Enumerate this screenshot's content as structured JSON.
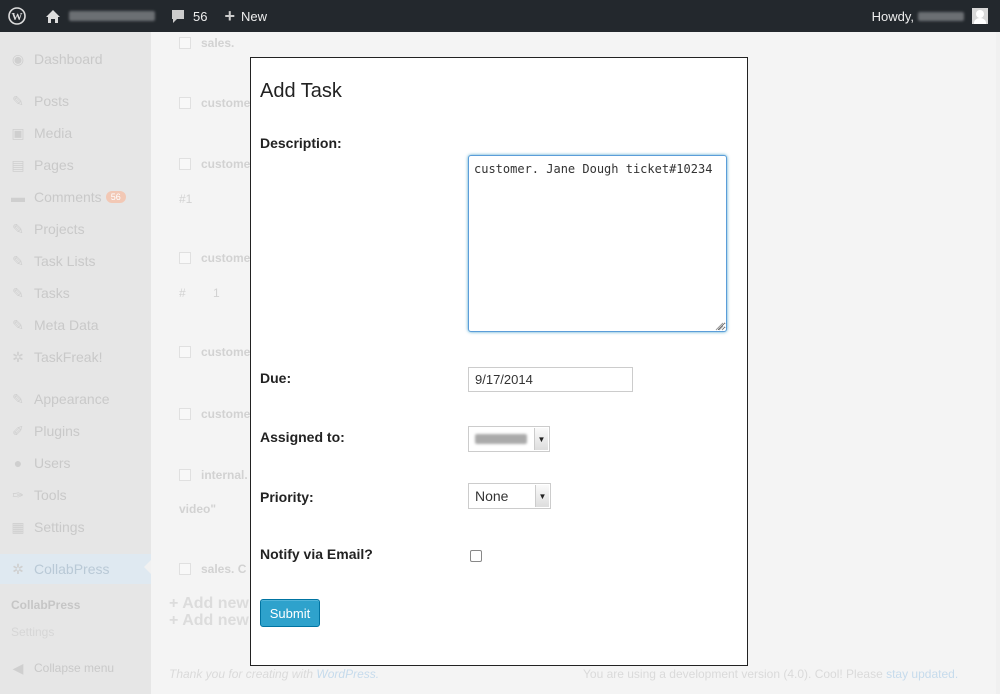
{
  "admin_bar": {
    "comments_count": "56",
    "new_label": "New",
    "howdy": "Howdy,"
  },
  "sidebar": {
    "items": [
      {
        "label": "Dashboard",
        "icon": "dashboard-icon"
      },
      {
        "label": "Posts",
        "icon": "pin-icon"
      },
      {
        "label": "Media",
        "icon": "media-icon"
      },
      {
        "label": "Pages",
        "icon": "pages-icon"
      },
      {
        "label": "Comments",
        "icon": "comment-icon",
        "badge": "56"
      },
      {
        "label": "Projects",
        "icon": "pin-icon"
      },
      {
        "label": "Task Lists",
        "icon": "pin-icon"
      },
      {
        "label": "Tasks",
        "icon": "pin-icon"
      },
      {
        "label": "Meta Data",
        "icon": "pin-icon"
      },
      {
        "label": "TaskFreak!",
        "icon": "gear-icon"
      },
      {
        "label": "Appearance",
        "icon": "brush-icon"
      },
      {
        "label": "Plugins",
        "icon": "plug-icon"
      },
      {
        "label": "Users",
        "icon": "user-icon"
      },
      {
        "label": "Tools",
        "icon": "wrench-icon"
      },
      {
        "label": "Settings",
        "icon": "settings-icon"
      },
      {
        "label": "CollabPress",
        "icon": "gear-icon"
      }
    ],
    "submenu": [
      "CollabPress",
      "Settings"
    ],
    "collapse_label": "Collapse menu"
  },
  "background": {
    "rows": [
      "sales.",
      "custome",
      "custome",
      "custome",
      "custome",
      "custome",
      "internal.",
      "sales. C"
    ],
    "notes": [
      "#1",
      "#",
      "1",
      "video\""
    ],
    "add_new": [
      "+ Add new",
      "+ Add new"
    ],
    "footer_left_prefix": "Thank you for creating with",
    "footer_left_link": "WordPress.",
    "footer_right_prefix": "You are using a development version (4.0). Cool! Please",
    "footer_right_link": "stay updated."
  },
  "modal": {
    "title": "Add Task",
    "description_label": "Description:",
    "description_value": "customer. Jane Dough ticket#10234",
    "due_label": "Due:",
    "due_value": "9/17/2014",
    "assigned_label": "Assigned to:",
    "priority_label": "Priority:",
    "priority_value": "None",
    "notify_label": "Notify via Email?",
    "notify_checked": false,
    "submit_label": "Submit"
  },
  "colors": {
    "admin_bar": "#23282d",
    "submit": "#2ea2cc",
    "focus": "#5b9dd9"
  }
}
